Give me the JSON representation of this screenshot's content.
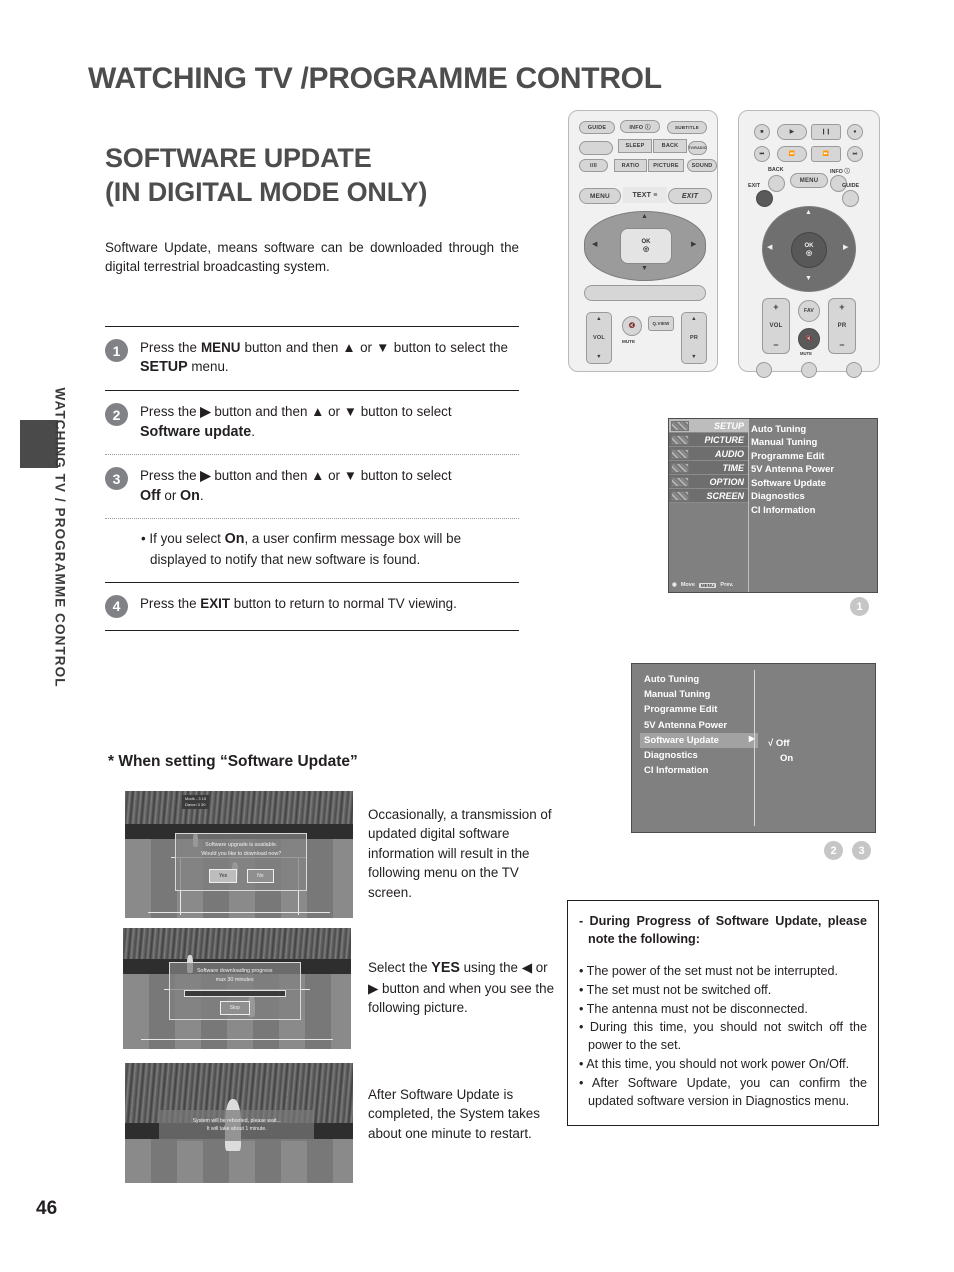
{
  "page": {
    "header": "WATCHING TV /PROGRAMME CONTROL",
    "side_tab": "WATCHING TV / PROGRAMME CONTROL",
    "number": "46"
  },
  "section": {
    "title_line1": "SOFTWARE UPDATE",
    "title_line2": "(IN DIGITAL MODE ONLY)",
    "intro": "Software Update, means software can be downloaded through the digital terrestrial broadcasting system."
  },
  "steps": [
    {
      "num": "1",
      "text_parts": [
        "Press the ",
        "MENU",
        " button and then ",
        "▲",
        " or ",
        "▼",
        " button to select the ",
        "SETUP",
        " menu."
      ]
    },
    {
      "num": "2",
      "text_parts": [
        "Press the ",
        "▶",
        " button and then ",
        "▲",
        " or ",
        "▼",
        " button to select ",
        "Software update",
        "."
      ]
    },
    {
      "num": "3",
      "text_parts": [
        "Press the ",
        "▶",
        " button and then ",
        "▲",
        " or ",
        "▼",
        " button to select ",
        "Off",
        " or ",
        "On",
        "."
      ]
    },
    {
      "num": "4",
      "text_parts": [
        "Press the ",
        "EXIT",
        " button to return to normal TV viewing."
      ]
    }
  ],
  "step_note": {
    "prefix": "• If you select ",
    "bold": "On",
    "suffix": ", a user confirm message box will be displayed to notify that new software is found."
  },
  "when_setting": {
    "heading": "* When setting “Software Update”",
    "rows": [
      {
        "desc": "Occasionally, a transmission of updated digital software information will result in the following menu on the TV screen.",
        "dialog_line1": "Software upgrade is available.",
        "dialog_line2": "Would you like to download now?",
        "btn_yes": "Yes",
        "btn_no": "No",
        "scorebug_line1": "Modk  - 3  15",
        "scorebug_line2": "Davon  3  30"
      },
      {
        "desc_parts": [
          "Select the ",
          "YES",
          " using the ",
          "◀",
          " or ",
          "▶",
          " button and when you see the following picture."
        ],
        "dialog_line1": "Software downloading progress",
        "dialog_line2": "max 30 minutes",
        "btn_stop": "Stop"
      },
      {
        "desc": "After Software Update is completed, the System takes about one minute to restart.",
        "banner_line1": "System will be rebooted, please wait...",
        "banner_line2": "It will take about 1 minute."
      }
    ]
  },
  "osd_menu_1": {
    "tabs": [
      {
        "label": "SETUP",
        "active": true
      },
      {
        "label": "PICTURE",
        "active": false
      },
      {
        "label": "AUDIO",
        "active": false
      },
      {
        "label": "TIME",
        "active": false
      },
      {
        "label": "OPTION",
        "active": false
      },
      {
        "label": "SCREEN",
        "active": false
      }
    ],
    "items": [
      "Auto Tuning",
      "Manual Tuning",
      "Programme Edit",
      "5V Antenna Power",
      "Software Update",
      "Diagnostics",
      "CI Information"
    ],
    "hint_move": "Move",
    "hint_menu_key": "MENU",
    "hint_prev": "Prev.",
    "marker": "1"
  },
  "osd_menu_2": {
    "items": [
      {
        "label": "Auto Tuning",
        "selected": false,
        "caret": ""
      },
      {
        "label": "Manual Tuning",
        "selected": false,
        "caret": ""
      },
      {
        "label": "Programme Edit",
        "selected": false,
        "caret": ""
      },
      {
        "label": "5V Antenna Power",
        "selected": false,
        "caret": ""
      },
      {
        "label": "Software Update",
        "selected": true,
        "caret": "▶"
      },
      {
        "label": "Diagnostics",
        "selected": false,
        "caret": ""
      },
      {
        "label": "CI Information",
        "selected": false,
        "caret": ""
      }
    ],
    "option_off": "√ Off",
    "option_on": "On",
    "marker_a": "2",
    "marker_b": "3"
  },
  "caution": {
    "title": "- During Progress of Software Update, please note the following:",
    "items": [
      "• The power of the set must not be interrupted.",
      "• The set must not be switched off.",
      "• The antenna must not be disconnected.",
      "• During this time, you should not switch off the power to the set.",
      "• At this time, you should not work power On/Off.",
      "• After Software Update, you can confirm the updated software version in Diagnostics menu."
    ]
  },
  "remote_1": {
    "buttons": [
      "GUIDE",
      "INFO ⓘ",
      "SUBTITLE",
      "SLEEP",
      "BACK",
      "TV/RADIO",
      "I/II",
      "RATIO",
      "PICTURE",
      "SOUND",
      "MENU",
      "TEXT ≡",
      "EXIT",
      "OK",
      "VOL",
      "MUTE",
      "Q.VIEW",
      "PR"
    ]
  },
  "remote_2": {
    "buttons": [
      "BACK",
      "MENU",
      "INFO ⓘ",
      "EXIT",
      "GUIDE",
      "OK",
      "VOL",
      "FAV",
      "MUTE",
      "PR"
    ]
  },
  "colors": {
    "title_gray": "#4d4d4d",
    "step_circle": "#808285",
    "osd_bg": "#808080",
    "marker": "#c6c6c6"
  }
}
